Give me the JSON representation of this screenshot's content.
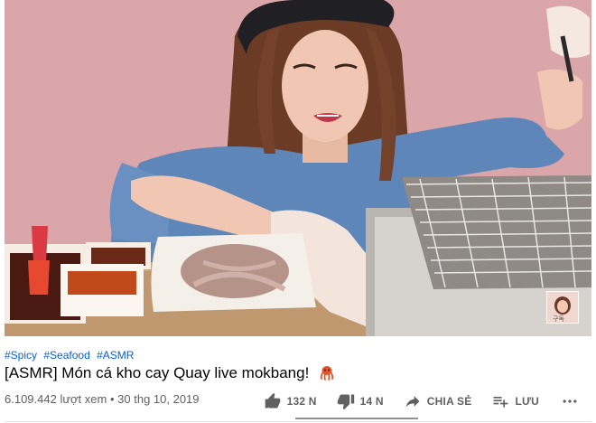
{
  "video": {
    "watermark_text": "구독"
  },
  "tags": [
    "#Spicy",
    "#Seafood",
    "#ASMR"
  ],
  "title": "[ASMR] Món cá kho cay Quay live mokbang!",
  "views": "6.109.442 lượt xem",
  "separator": "•",
  "date": "30 thg 10, 2019",
  "actions": {
    "like_count": "132 N",
    "dislike_count": "14 N",
    "share_label": "CHIA SẺ",
    "save_label": "LƯU"
  },
  "icons": {
    "like": "thumbs-up-icon",
    "dislike": "thumbs-down-icon",
    "share": "share-arrow-icon",
    "save": "playlist-add-icon",
    "more": "more-horizontal-icon",
    "title_emoji": "octopus-icon"
  },
  "colors": {
    "hashtag": "#065fd4",
    "secondary_text": "#606060",
    "primary_text": "#030303"
  }
}
